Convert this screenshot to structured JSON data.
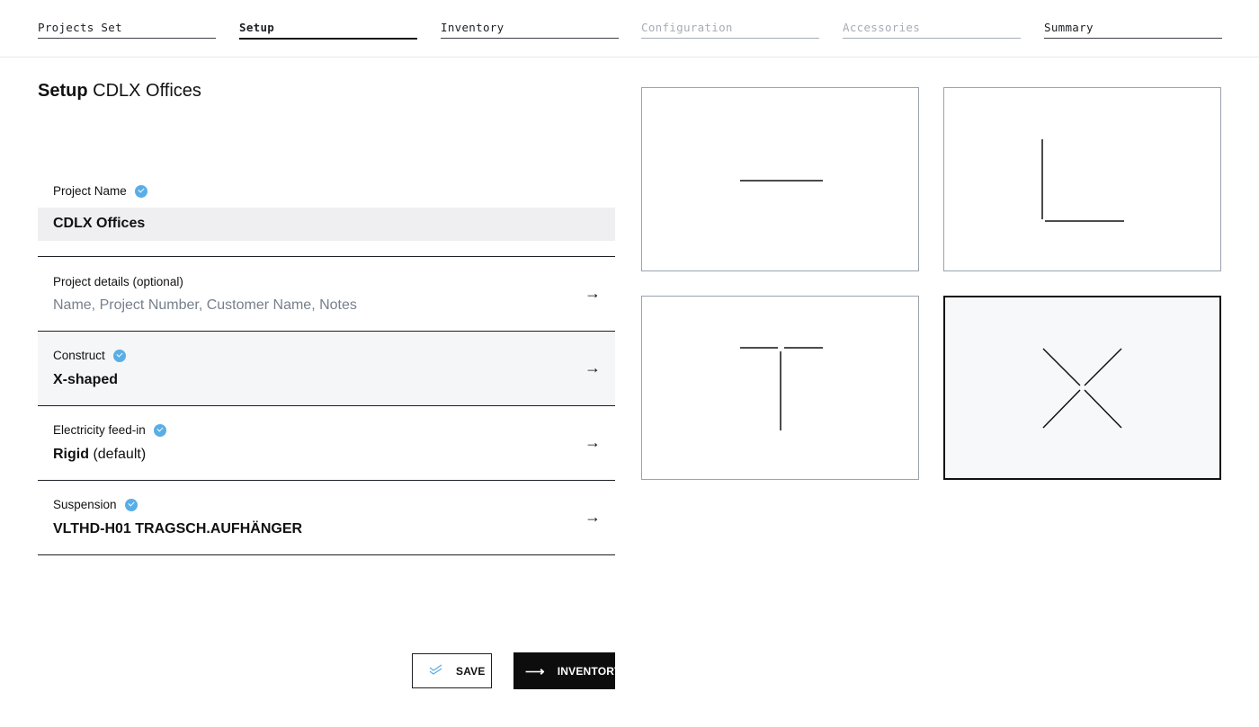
{
  "steps": [
    {
      "label": "Projects Set",
      "state": "done"
    },
    {
      "label": "Setup",
      "state": "active"
    },
    {
      "label": "Inventory",
      "state": "enabled"
    },
    {
      "label": "Configuration",
      "state": "disabled"
    },
    {
      "label": "Accessories",
      "state": "disabled"
    },
    {
      "label": "Summary",
      "state": "enabled"
    }
  ],
  "title": {
    "bold": "Setup",
    "name": "CDLX Offices"
  },
  "form": {
    "project_name": {
      "label": "Project Name",
      "value": "CDLX Offices",
      "verified": true
    },
    "project_details": {
      "label": "Project details (optional)",
      "placeholder": "Name, Project Number, Customer Name, Notes",
      "arrow": "→"
    },
    "construct": {
      "label": "Construct",
      "value": "X-shaped",
      "verified": true,
      "arrow": "→"
    },
    "electricity": {
      "label": "Electricity feed-in",
      "value": "Rigid",
      "suffix": " (default)",
      "verified": true,
      "arrow": "→"
    },
    "suspension": {
      "label": "Suspension",
      "value": "VLTHD-H01 TRAGSCH.AUFHÄNGER",
      "verified": true,
      "arrow": "→"
    }
  },
  "shapes": [
    {
      "name": "I-shaped",
      "icon": "straight-line-icon",
      "selected": false
    },
    {
      "name": "L-shaped",
      "icon": "l-shape-icon",
      "selected": false
    },
    {
      "name": "T-shaped",
      "icon": "t-shape-icon",
      "selected": false
    },
    {
      "name": "X-shaped",
      "icon": "x-shape-icon",
      "selected": true
    }
  ],
  "buttons": {
    "save": {
      "label": "SAVE",
      "icon": "double-check-icon"
    },
    "inventory": {
      "label": "INVENTORY",
      "icon": "arrow-right-icon",
      "icon_glyph": "⟶"
    }
  },
  "colors": {
    "accent": "#5aaee6",
    "primary": "#0d0d0d",
    "highlight_row": "#f5f6f8",
    "name_field": "#efeff2"
  }
}
